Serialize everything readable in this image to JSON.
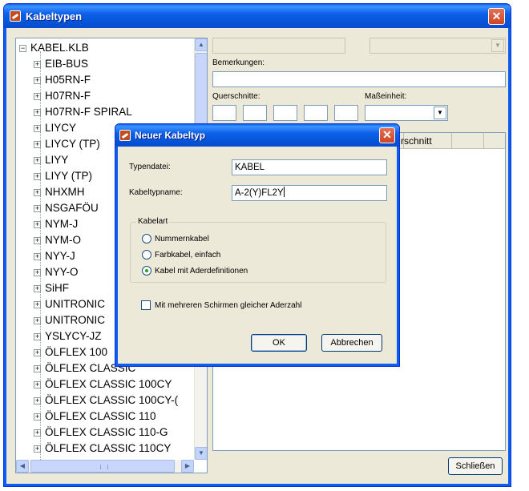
{
  "window": {
    "title": "Kabeltypen",
    "close_glyph": "✕",
    "icon": "app-icon"
  },
  "tree": {
    "root_label": "KABEL.KLB",
    "root_expander": "−",
    "child_expander": "+",
    "items": [
      "EIB-BUS",
      "H05RN-F",
      "H07RN-F",
      "H07RN-F SPIRAL",
      "LIYCY",
      "LIYCY (TP)",
      "LIYY",
      "LIYY (TP)",
      "NHXMH",
      "NSGAFÖU",
      "NYM-J",
      "NYM-O",
      "NYY-J",
      "NYY-O",
      "SiHF",
      "UNITRONIC",
      "UNITRONIC",
      "YSLYCY-JZ",
      "ÖLFLEX 100",
      "ÖLFLEX CLASSIC",
      "ÖLFLEX CLASSIC 100CY",
      "ÖLFLEX CLASSIC 100CY-(",
      "ÖLFLEX CLASSIC 110",
      "ÖLFLEX CLASSIC 110-G",
      "ÖLFLEX CLASSIC 110CY"
    ]
  },
  "right": {
    "bemerkungen_label": "Bemerkungen:",
    "querschnitte_label": "Querschnitte:",
    "masseinheit_label": "Maßeinheit:",
    "list_column_2": "rschnitt",
    "close_button": "Schließen"
  },
  "dialog": {
    "title": "Neuer Kabeltyp",
    "close_glyph": "✕",
    "typendatei_label": "Typendatei:",
    "typendatei_value": "KABEL",
    "kabeltypname_label": "Kabeltypname:",
    "kabeltypname_value": "A-2(Y)FL2Y",
    "kabelart_legend": "Kabelart",
    "radios": [
      {
        "label": "Nummernkabel",
        "selected": false
      },
      {
        "label": "Farbkabel, einfach",
        "selected": false
      },
      {
        "label": "Kabel mit Aderdefinitionen",
        "selected": true
      }
    ],
    "checkbox_label": "Mit mehreren Schirmen gleicher Aderzahl",
    "checkbox_checked": false,
    "ok_button": "OK",
    "cancel_button": "Abbrechen"
  },
  "colors": {
    "titlebar": "#0a5fe7",
    "face": "#ece9d8",
    "close_red": "#d85a3a",
    "field_border": "#7f9db9"
  }
}
